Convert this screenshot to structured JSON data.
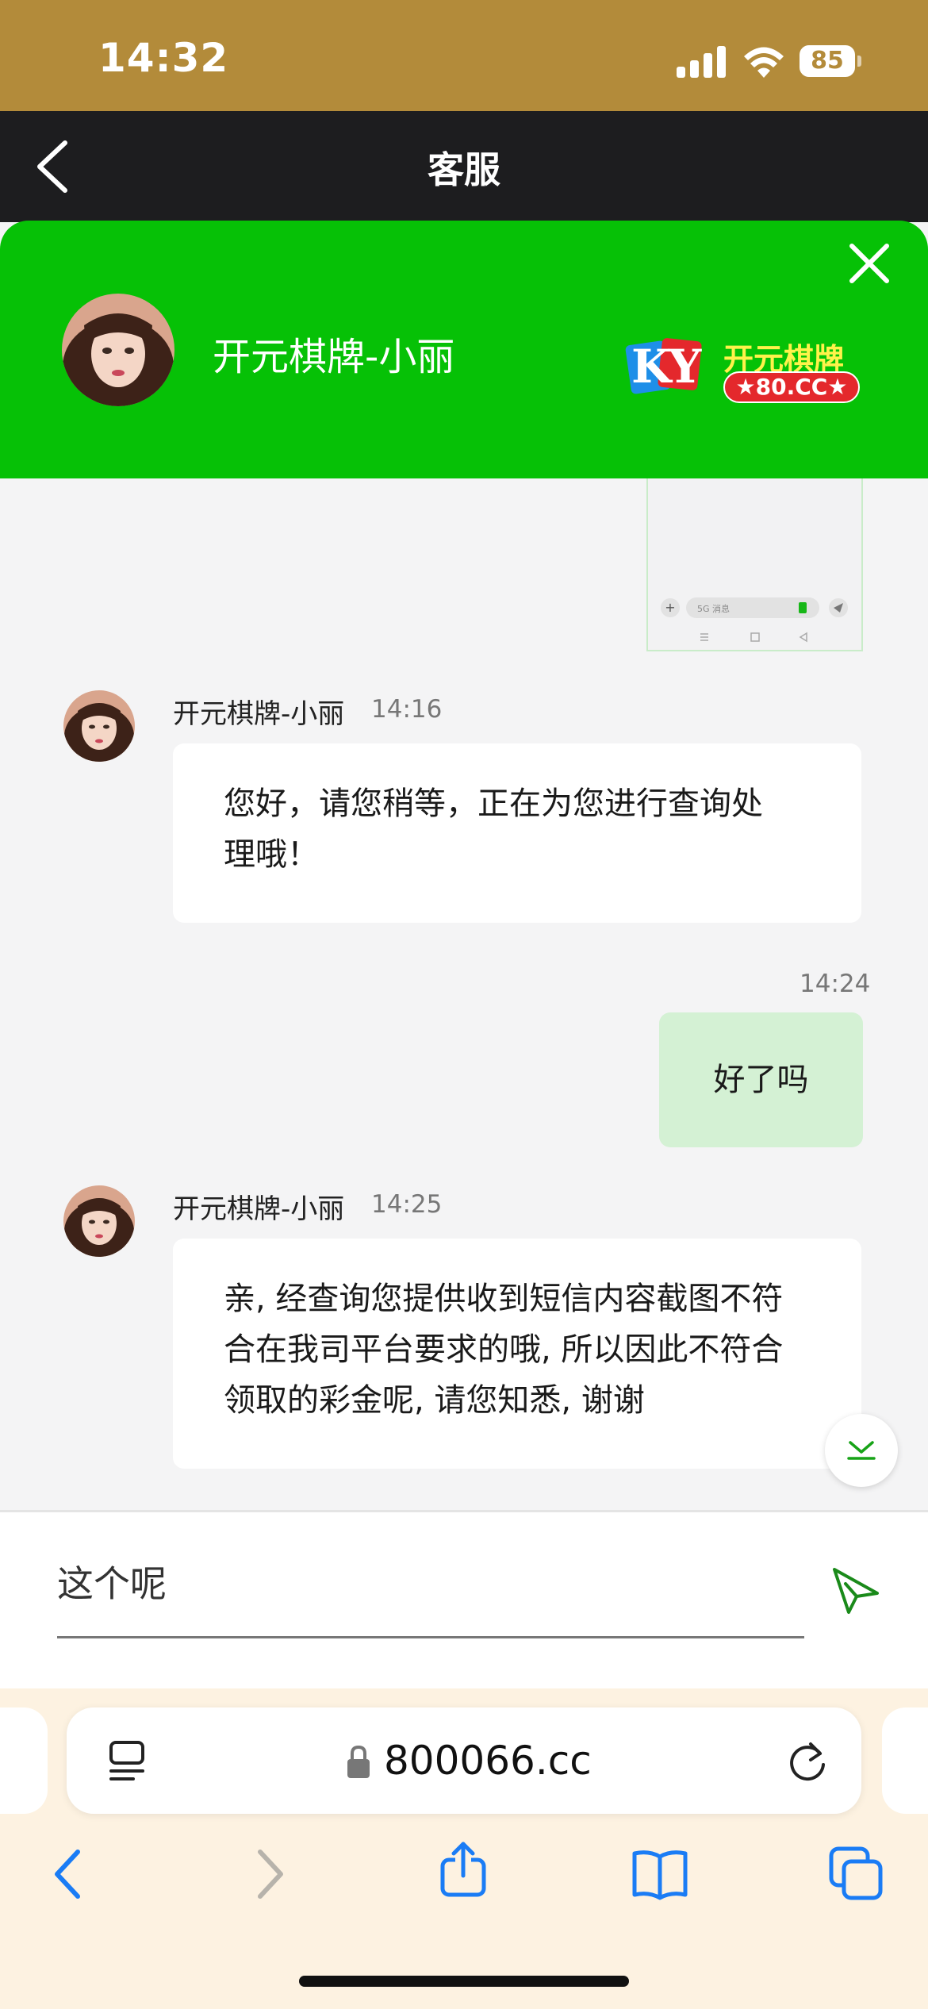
{
  "status_bar": {
    "time": "14:32",
    "battery": "85"
  },
  "header": {
    "title": "客服"
  },
  "agent": {
    "name": "开元棋牌-小丽",
    "logo_letters": "KY",
    "logo_title": "开元棋牌",
    "logo_domain": "★80.CC★"
  },
  "thumbnail": {
    "input_hint": "5G 消息"
  },
  "messages": [
    {
      "sender": "开元棋牌-小丽",
      "time": "14:16",
      "line1": "您好，请您稍等，正在为您进行查询处",
      "line2": "理哦！"
    },
    {
      "time": "14:24",
      "text": "好了吗"
    },
    {
      "sender": "开元棋牌-小丽",
      "time": "14:25",
      "line1": "亲, 经查询您提供收到短信内容截图不符",
      "line2": "合在我司平台要求的哦, 所以因此不符合",
      "line3": "领取的彩金呢, 请您知悉, 谢谢"
    }
  ],
  "input": {
    "value": "这个呢"
  },
  "browser": {
    "url": "800066.cc"
  },
  "colors": {
    "status": "#b38b3a",
    "header": "#1d1d1f",
    "green": "#06c106",
    "outgoing": "#d4f1d4",
    "browser": "#fdf2e1",
    "accent_blue": "#1a7cf5"
  },
  "icons": [
    "back-icon",
    "close-icon",
    "send-icon",
    "scroll-down-icon",
    "reader-icon",
    "lock-icon",
    "reload-icon",
    "nav-back-icon",
    "nav-forward-icon",
    "share-icon",
    "bookmarks-icon",
    "tabs-icon"
  ]
}
